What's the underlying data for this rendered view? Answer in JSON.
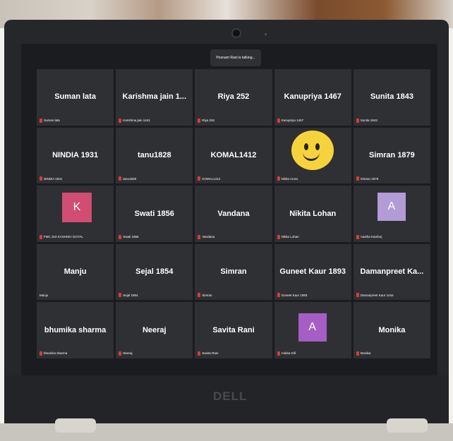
{
  "talking_banner": "Poonam Rani is talking...",
  "participants": [
    {
      "name": "Suman lata",
      "label": "Suman lata"
    },
    {
      "name": "Karishma jain 1...",
      "label": "Karishma jain 1441"
    },
    {
      "name": "Riya 252",
      "label": "Riya 252"
    },
    {
      "name": "Kanupriya 1467",
      "label": "Kanupriya 1467"
    },
    {
      "name": "Sunita 1843",
      "label": "Sunita 1843"
    },
    {
      "name": "NINDIA 1931",
      "label": "NINDIA 1931"
    },
    {
      "name": "tanu1828",
      "label": "tanu1828"
    },
    {
      "name": "KOMAL1412",
      "label": "KOMAL1412"
    },
    {
      "name": "",
      "label": "Nikita Arora"
    },
    {
      "name": "Simran 1879",
      "label": "Simran 1879"
    },
    {
      "name": "",
      "label": "FMC 310 KASHISH GOYAL",
      "avatar": "K"
    },
    {
      "name": "Swati 1856",
      "label": "Swati 1856"
    },
    {
      "name": "Vandana",
      "label": "Vandana"
    },
    {
      "name": "Nikita Lohan",
      "label": "Nikita Lohan"
    },
    {
      "name": "",
      "label": "Aastha Kamboj",
      "avatar": "A"
    },
    {
      "name": "Manju",
      "label": "Manju"
    },
    {
      "name": "Sejal 1854",
      "label": "Sejal 1854"
    },
    {
      "name": "Simran",
      "label": "Simran"
    },
    {
      "name": "Guneet Kaur 1893",
      "label": "Guneet Kaur 1893"
    },
    {
      "name": "Damanpreet Ka...",
      "label": "Damanpreet Kaur 1444"
    },
    {
      "name": "bhumika sharma",
      "label": "bhumika sharma"
    },
    {
      "name": "Neeraj",
      "label": "Neeraj"
    },
    {
      "name": "Savita Rani",
      "label": "Savita Rani"
    },
    {
      "name": "",
      "label": "Ankita Gill",
      "avatar": "A"
    },
    {
      "name": "Monika",
      "label": "Monika"
    }
  ],
  "brand_logo": "DELL",
  "colors": {
    "tile_bg": "#2f3033",
    "screen_bg": "#1b1c1f",
    "mic_red": "#d43d3d",
    "avatar_pink": "#d14d73",
    "avatar_lavender": "#b39bd6",
    "avatar_purple": "#a55ec5"
  }
}
